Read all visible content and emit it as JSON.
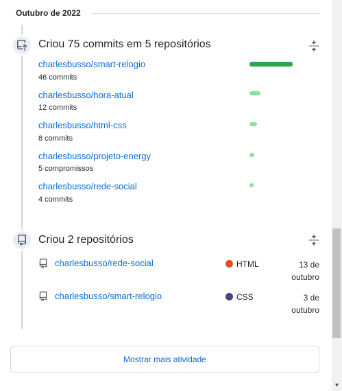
{
  "section": {
    "month_label": "Outubro de 2022"
  },
  "commits_group": {
    "title": "Criou 75 commits em 5 repositórios",
    "icon": "repo-push-icon",
    "fold_icon": "fold-icon",
    "items": [
      {
        "repo": "charlesbusso/smart-relogio",
        "count_label": "46 commits",
        "commits": 46
      },
      {
        "repo": "charlesbusso/hora-atual",
        "count_label": "12 commits",
        "commits": 12
      },
      {
        "repo": "charlesbusso/html-css",
        "count_label": "8 commits",
        "commits": 8
      },
      {
        "repo": "charlesbusso/projeto-energy",
        "count_label": "5 compromissos",
        "commits": 5
      },
      {
        "repo": "charlesbusso/rede-social",
        "count_label": "4 commits",
        "commits": 4
      }
    ],
    "bar_colors": {
      "high": "#2da44e",
      "low": "#8ce0a0"
    }
  },
  "repos_group": {
    "title": "Criou 2 repositórios",
    "icon": "repo-icon",
    "fold_icon": "fold-icon",
    "items": [
      {
        "repo": "charlesbusso/rede-social",
        "language": "HTML",
        "language_color": "#e34c26",
        "date_day": "13 de",
        "date_month": "outubro"
      },
      {
        "repo": "charlesbusso/smart-relogio",
        "language": "CSS",
        "language_color": "#563d7c",
        "date_day": "3 de",
        "date_month": "outubro"
      }
    ]
  },
  "footer": {
    "more_button_label": "Mostrar mais atividade"
  },
  "colors": {
    "link": "#0969da",
    "border": "#d0d7de"
  }
}
